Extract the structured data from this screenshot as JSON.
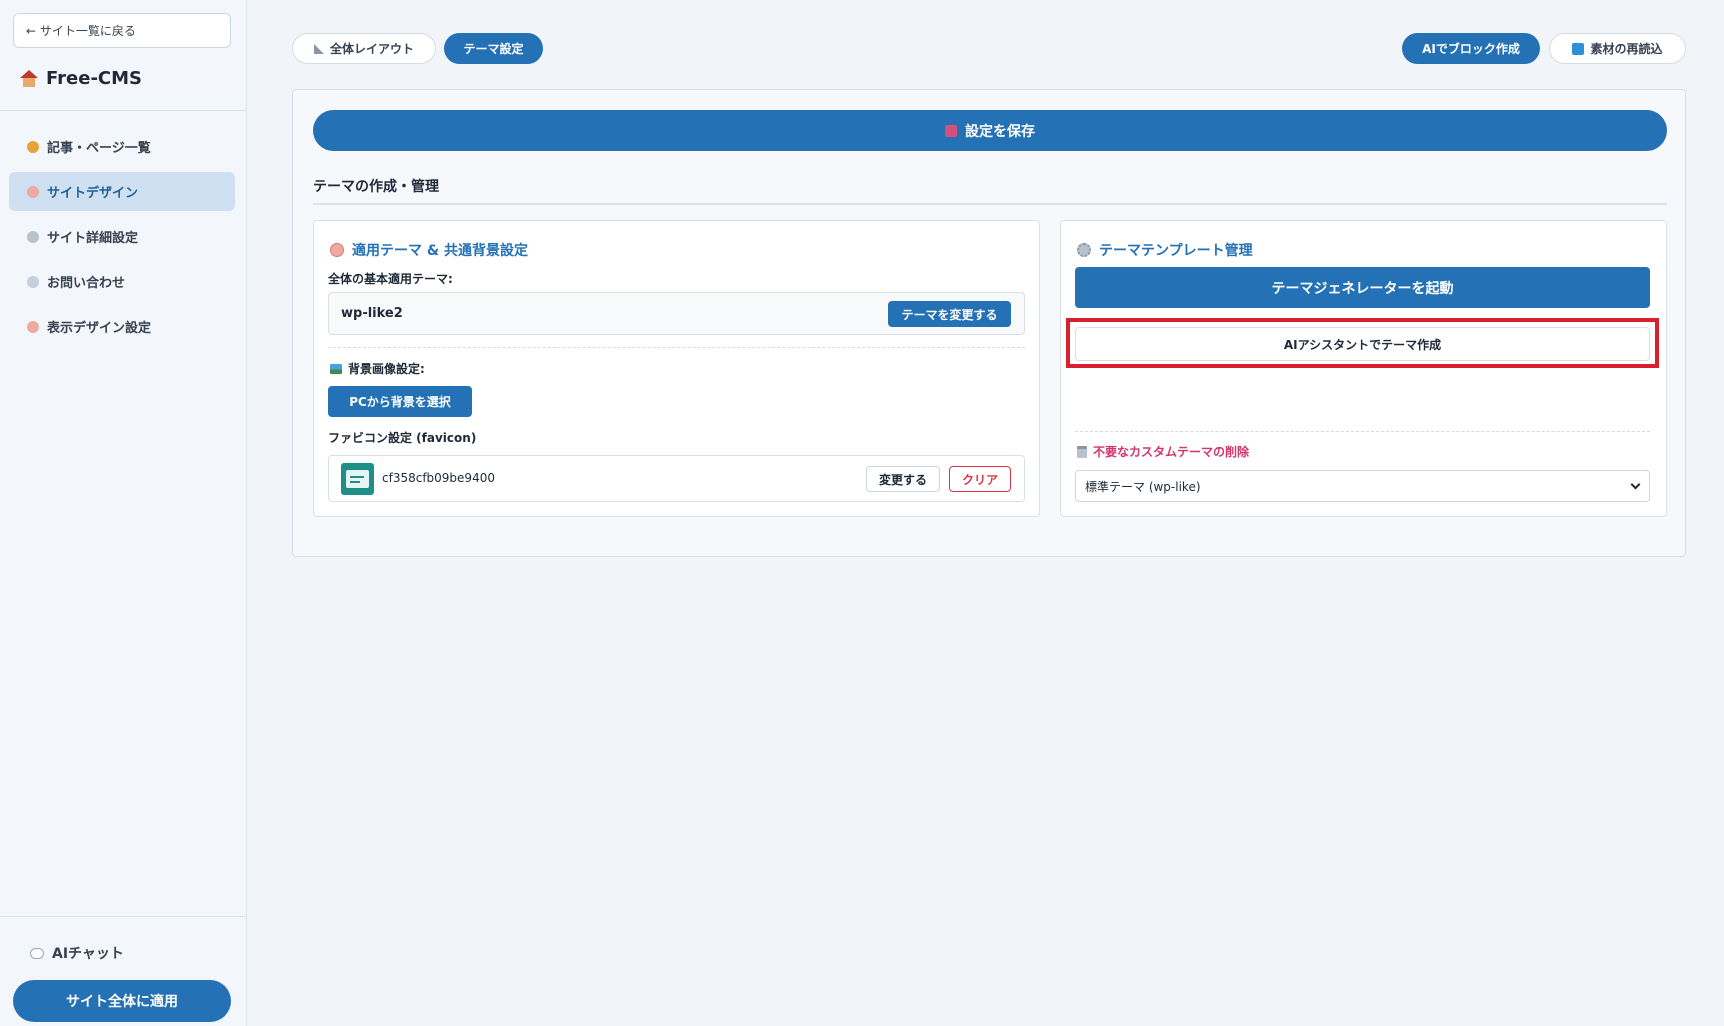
{
  "sidebar": {
    "back_label": "← サイト一覧に戻る",
    "brand_name": "Free-CMS",
    "items": [
      {
        "label": "記事・ページ一覧",
        "icon": "pencil-icon",
        "icon_color": "#e8a23a"
      },
      {
        "label": "サイトデザイン",
        "icon": "palette-icon",
        "icon_color": "#f0a9a0",
        "active": true
      },
      {
        "label": "サイト詳細設定",
        "icon": "gear-icon",
        "icon_color": "#b8c1cc"
      },
      {
        "label": "お問い合わせ",
        "icon": "mail-icon",
        "icon_color": "#c6cfe0"
      },
      {
        "label": "表示デザイン設定",
        "icon": "palette-icon",
        "icon_color": "#f0a9a0"
      }
    ],
    "ai_chat_label": "AIチャット",
    "apply_label": "サイト全体に適用"
  },
  "tabs": {
    "layout_label": "全体レイアウト",
    "theme_label": "テーマ設定",
    "ai_block_label": "AIでブロック作成",
    "reload_label": "素材の再読込"
  },
  "main": {
    "save_label": "設定を保存",
    "section_title": "テーマの作成・管理",
    "left_card": {
      "heading": "適用テーマ & 共通背景設定",
      "base_theme_label": "全体の基本適用テーマ:",
      "current_theme": "wp-like2",
      "change_theme_label": "テーマを変更する",
      "bg_label": "背景画像設定:",
      "bg_button": "PCから背景を選択",
      "favicon_label": "ファビコン設定 (favicon)",
      "favicon_name": "cf358cfb09be9400",
      "favicon_change": "変更する",
      "favicon_clear": "クリア"
    },
    "right_card": {
      "heading": "テーマテンプレート管理",
      "generator_button": "テーマジェネレーターを起動",
      "ai_assist_button": "AIアシスタントでテーマ作成",
      "delete_heading": "不要なカスタムテーマの削除",
      "delete_select_value": "標準テーマ (wp-like)"
    }
  },
  "colors": {
    "accent": "#2471b5",
    "highlight": "#d9202f",
    "danger": "#dc3545",
    "delete_text": "#d6336c",
    "background": "#f1f5fa"
  }
}
